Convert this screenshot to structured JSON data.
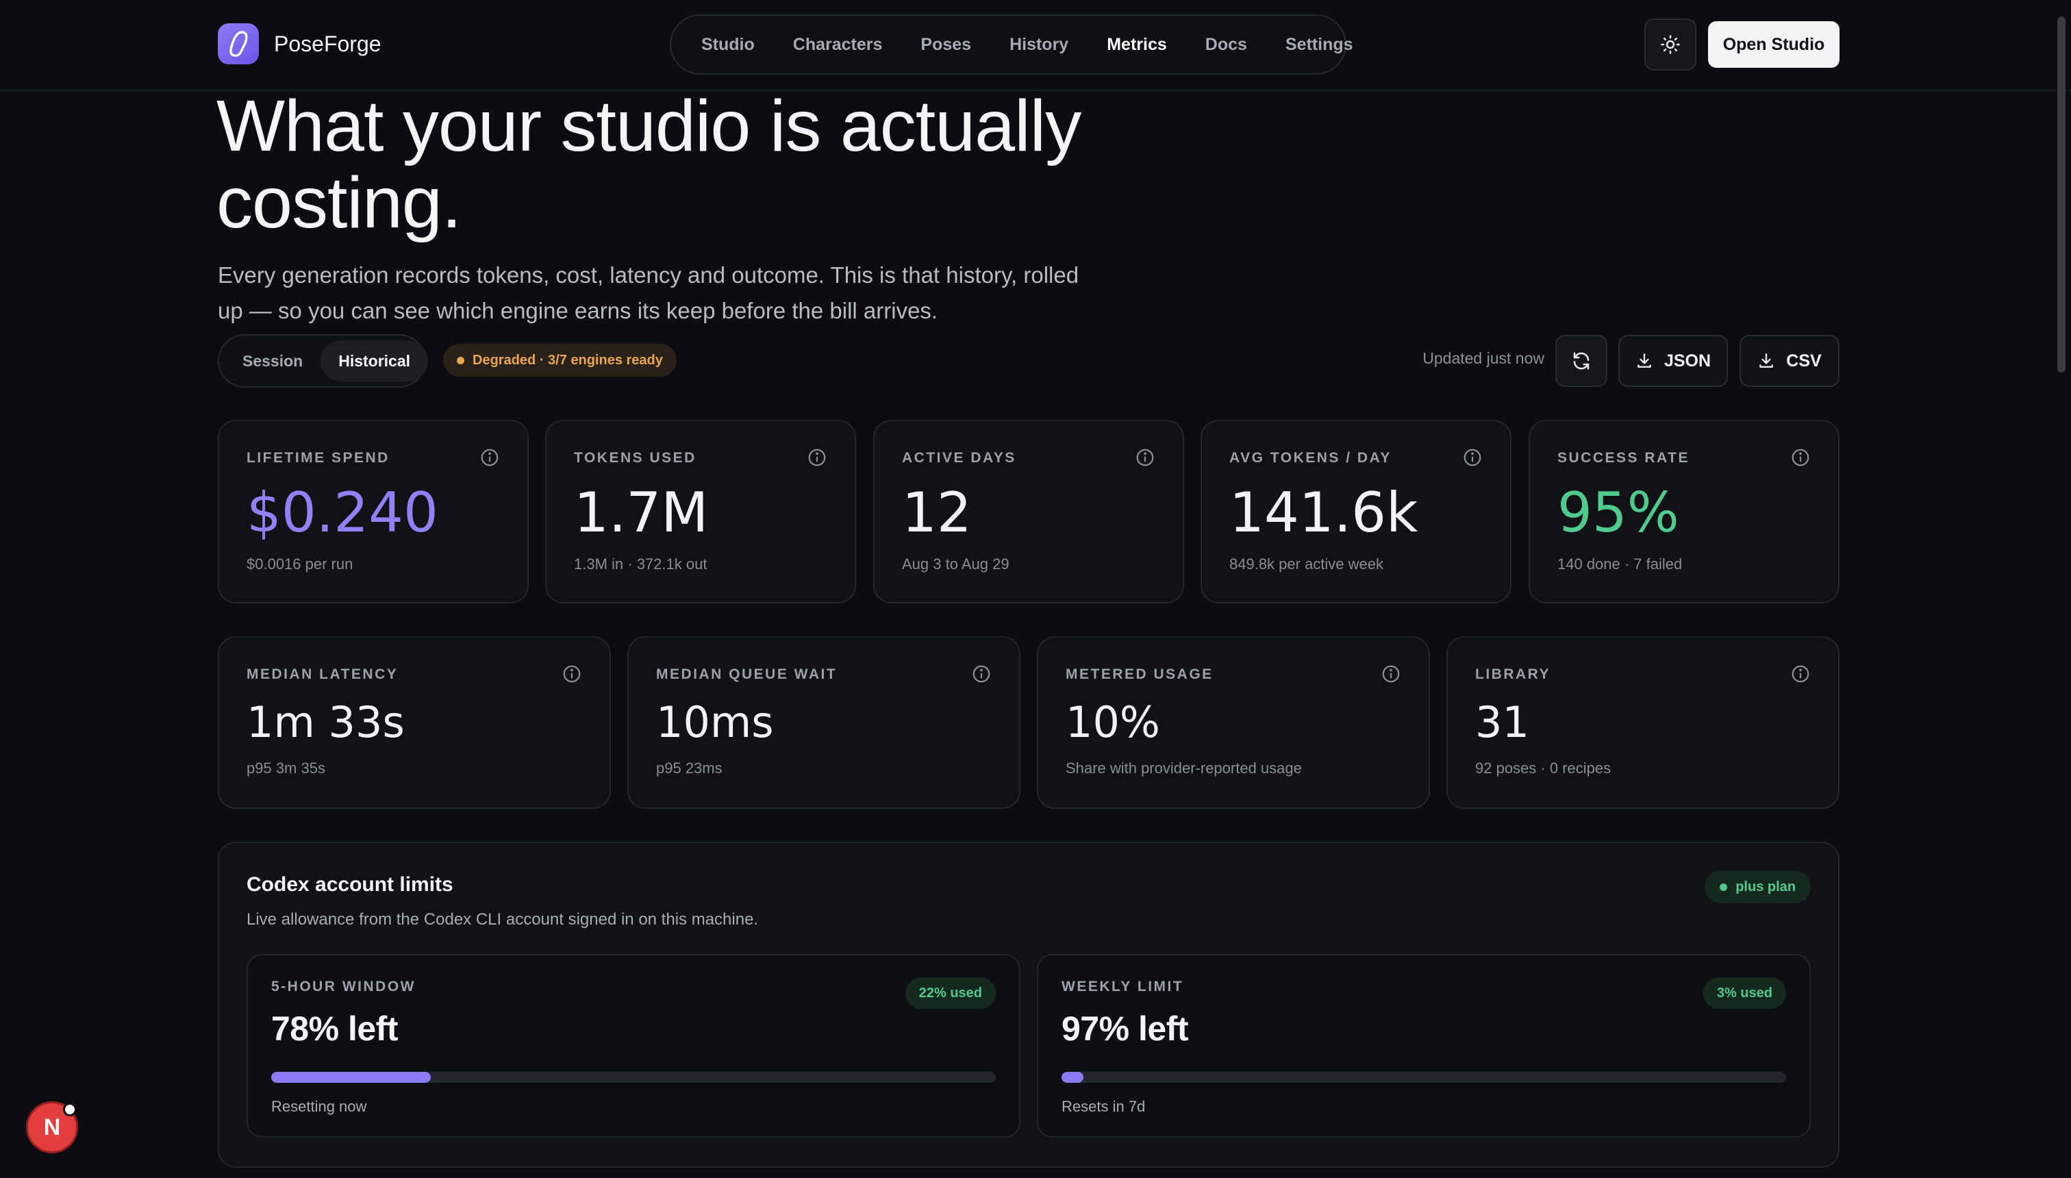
{
  "brand": {
    "name": "PoseForge"
  },
  "nav": {
    "items": [
      {
        "label": "Studio",
        "active": false
      },
      {
        "label": "Characters",
        "active": false
      },
      {
        "label": "Poses",
        "active": false
      },
      {
        "label": "History",
        "active": false
      },
      {
        "label": "Metrics",
        "active": true
      },
      {
        "label": "Docs",
        "active": false
      },
      {
        "label": "Settings",
        "active": false
      }
    ],
    "open_studio_label": "Open Studio"
  },
  "hero": {
    "title": "What your studio is actually costing.",
    "subtitle": "Every generation records tokens, cost, latency and outcome. This is that history, rolled up — so you can see which engine earns its keep before the bill arrives."
  },
  "controls": {
    "segments": [
      {
        "label": "Session",
        "active": false
      },
      {
        "label": "Historical",
        "active": true
      }
    ],
    "status": "Degraded · 3/7 engines ready",
    "updated": "Updated just now",
    "json_label": "JSON",
    "csv_label": "CSV"
  },
  "stats_row1": [
    {
      "label": "LIFETIME SPEND",
      "value": "$0.240",
      "sub": "$0.0016 per run",
      "accent": "purple"
    },
    {
      "label": "TOKENS USED",
      "value": "1.7M",
      "sub": "1.3M in · 372.1k out",
      "accent": ""
    },
    {
      "label": "ACTIVE DAYS",
      "value": "12",
      "sub": "Aug 3 to Aug 29",
      "accent": ""
    },
    {
      "label": "AVG TOKENS / DAY",
      "value": "141.6k",
      "sub": "849.8k per active week",
      "accent": ""
    },
    {
      "label": "SUCCESS RATE",
      "value": "95%",
      "sub": "140 done · 7 failed",
      "accent": "green"
    }
  ],
  "stats_row2": [
    {
      "label": "MEDIAN LATENCY",
      "value": "1m 33s",
      "sub": "p95 3m 35s"
    },
    {
      "label": "MEDIAN QUEUE WAIT",
      "value": "10ms",
      "sub": "p95 23ms"
    },
    {
      "label": "METERED USAGE",
      "value": "10%",
      "sub": "Share with provider-reported usage"
    },
    {
      "label": "LIBRARY",
      "value": "31",
      "sub": "92 poses · 0 recipes"
    }
  ],
  "codex": {
    "title": "Codex account limits",
    "subtitle": "Live allowance from the Codex CLI account signed in on this machine.",
    "plan": "plus plan",
    "limits": [
      {
        "label": "5-HOUR WINDOW",
        "value": "78% left",
        "used": "22% used",
        "used_fraction": 0.22,
        "foot": "Resetting now"
      },
      {
        "label": "WEEKLY LIMIT",
        "value": "97% left",
        "used": "3% used",
        "used_fraction": 0.03,
        "foot": "Resets in 7d"
      }
    ]
  },
  "floating_badge": {
    "letter": "N"
  },
  "colors": {
    "accent": "#8b7cf6",
    "success": "#4fcb8e",
    "warning": "#e9a653",
    "background": "#0c0d10"
  },
  "icons": [
    "sun-icon",
    "refresh-icon",
    "download-icon",
    "info-icon",
    "logo-icon"
  ]
}
